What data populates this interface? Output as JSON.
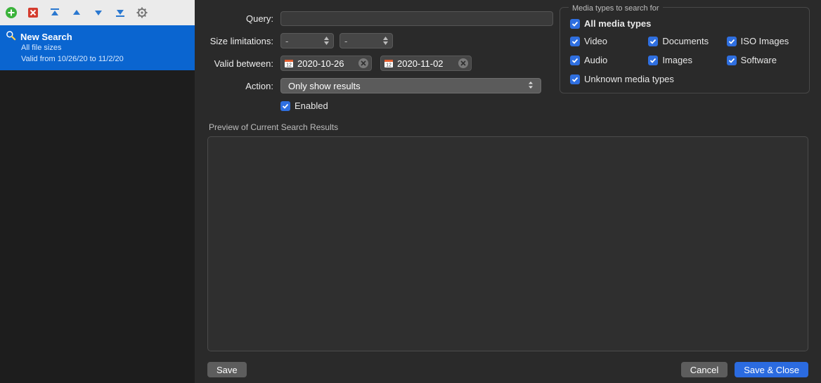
{
  "sidebar": {
    "item": {
      "title": "New Search",
      "sub1": "All file sizes",
      "sub2": "Valid from 10/26/20 to 11/2/20"
    }
  },
  "form": {
    "query_label": "Query:",
    "query_value": "",
    "size_label": "Size limitations:",
    "size_min": "-",
    "size_max": "-",
    "valid_label": "Valid between:",
    "date_from": "2020-10-26",
    "date_to": "2020-11-02",
    "action_label": "Action:",
    "action_value": "Only show results",
    "enabled_label": "Enabled"
  },
  "media": {
    "legend": "Media types to search for",
    "all": "All media types",
    "video": "Video",
    "documents": "Documents",
    "iso": "ISO Images",
    "audio": "Audio",
    "images": "Images",
    "software": "Software",
    "unknown": "Unknown media types"
  },
  "preview_label": "Preview of Current Search Results",
  "buttons": {
    "save": "Save",
    "cancel": "Cancel",
    "save_close": "Save & Close"
  }
}
